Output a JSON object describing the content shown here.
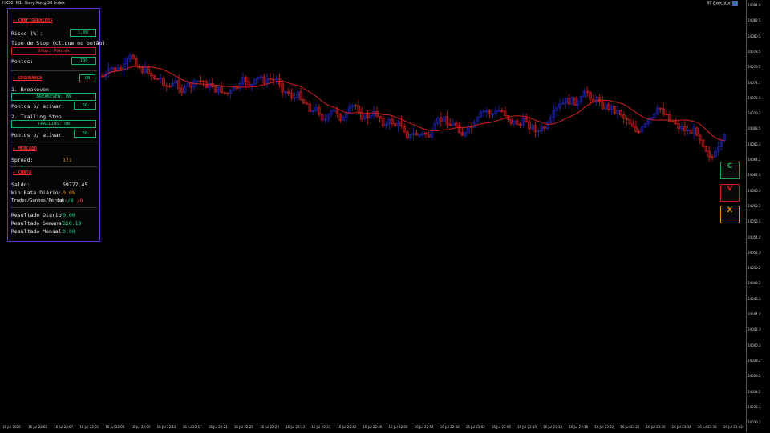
{
  "header": {
    "symbol": "HK50, M1: Hong Kong 50 Index",
    "ea_name": "RT Executor"
  },
  "colors": {
    "bull": "#1b1f9e",
    "bear": "#b51a1a",
    "ma": "#d22020",
    "panel_border": "#6b2fbf",
    "accent_green": "#22dd88",
    "accent_red": "#ff2a2a",
    "accent_orange": "#e09020"
  },
  "y_axis": [
    "24084.0",
    "24082.5",
    "24080.5",
    "24078.5",
    "24076.5",
    "24074.7",
    "24072.5",
    "24070.2",
    "24068.5",
    "24066.3",
    "24064.2",
    "24062.3",
    "24060.3",
    "24058.2",
    "24056.5",
    "24054.2",
    "24052.3",
    "24050.2",
    "24048.2",
    "24046.3",
    "24044.2",
    "24042.3",
    "24040.3",
    "24038.2",
    "24036.5",
    "24034.2",
    "24032.3",
    "24030.2"
  ],
  "x_axis": [
    "16 Jul 2026",
    "16 Jul 22:02",
    "16 Jul 22:07",
    "16 Jul 22:01",
    "16 Jul 22:05",
    "16 Jul 22:09",
    "16 Jul 22:13",
    "16 Jul 22:17",
    "16 Jul 22:21",
    "16 Jul 22:25",
    "16 Jul 22:29",
    "16 Jul 22:33",
    "16 Jul 22:37",
    "16 Jul 22:42",
    "16 Jul 22:46",
    "16 Jul 22:50",
    "16 Jul 22:54",
    "16 Jul 22:58",
    "16 Jul 23:02",
    "16 Jul 23:06",
    "16 Jul 23:10",
    "16 Jul 23:14",
    "16 Jul 23:18",
    "16 Jul 23:22",
    "16 Jul 23:26",
    "16 Jul 23:30",
    "16 Jul 23:34",
    "16 Jul 23:38",
    "16 Jul 23:42"
  ],
  "panel": {
    "config_title": "CONFIGURAÇÕES",
    "risk_label": "Risco (%):",
    "risk_value": "1.00",
    "stop_type_label": "Tipo de Stop (clique no botão):",
    "stop_button": "Stop: Pontos",
    "points_label": "Pontos:",
    "points_value": "100",
    "security_title": "SEGURANÇA",
    "security_toggle": "ON",
    "breakeven_label": "1. Breakeven",
    "breakeven_button": "BREAKEVEN: ON",
    "breakeven_points_label": "Pontos p/ ativar:",
    "breakeven_points_value": "50",
    "trailing_label": "2. Trailing Stop",
    "trailing_button": "TRAILING: ON",
    "trailing_points_label": "Pontos p/ ativar:",
    "trailing_points_value": "50",
    "market_title": "MERCADO",
    "spread_label": "Spread:",
    "spread_value": "171",
    "account_title": "CONTA",
    "balance_label": "Saldo:",
    "balance_value": "59777.45",
    "winrate_label": "Win Rate Diário:",
    "winrate_value": "0.0%",
    "trades_label": "Trades/Ganhos/Perdas:",
    "trades_total": "0",
    "trades_wins": "/0",
    "trades_losses": "/0",
    "daily_label": "Resultado Diário:",
    "daily_value": "0.00",
    "weekly_label": "Resultado Semanal:",
    "weekly_value": "610.10",
    "monthly_label": "Resultado Mensal:",
    "monthly_value": "0.00"
  },
  "side_buttons": [
    {
      "label": "C",
      "color": "#1aa050"
    },
    {
      "label": "V",
      "color": "#d01818"
    },
    {
      "label": "X",
      "color": "#e09020"
    }
  ]
}
